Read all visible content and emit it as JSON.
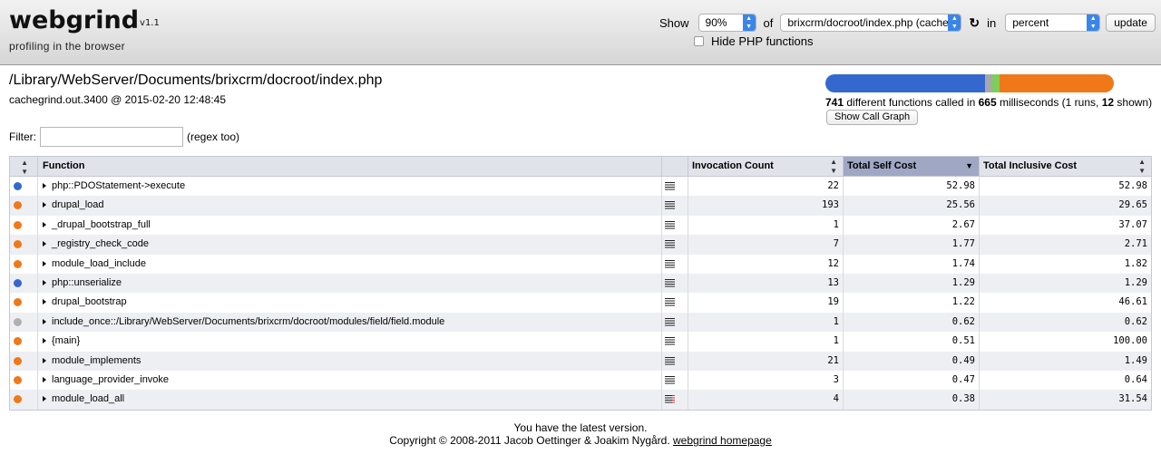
{
  "header": {
    "logo_name": "webgrind",
    "logo_version": "v1.1",
    "tagline": "profiling in the browser",
    "show_label": "Show",
    "percent_select": "90%",
    "of_label": "of",
    "file_select": "brixcrm/docroot/index.php (cache",
    "in_label": "in",
    "unit_select": "percent",
    "update_label": "update",
    "hide_php_label": "Hide PHP functions",
    "hide_php_checked": false
  },
  "file": {
    "path": "/Library/WebServer/Documents/brixcrm/docroot/index.php",
    "meta": "cachegrind.out.3400 @ 2015-02-20 12:48:45"
  },
  "filter": {
    "label": "Filter:",
    "value": "",
    "hint": "(regex too)"
  },
  "summary": {
    "functions": "741",
    "text1": "different functions called in",
    "ms": "665",
    "text2": "milliseconds (1 runs,",
    "shown": "12",
    "text3": "shown)",
    "call_graph_label": "Show Call Graph",
    "bar_segments": [
      {
        "name": "internal",
        "fraction": 0.555,
        "color": "#3468cf"
      },
      {
        "name": "include",
        "fraction": 0.025,
        "color": "#a8a8a8"
      },
      {
        "name": "class",
        "fraction": 0.025,
        "color": "#7ccf5a"
      },
      {
        "name": "user",
        "fraction": 0.395,
        "color": "#f07818"
      }
    ]
  },
  "table": {
    "headers": {
      "function": "Function",
      "invocation": "Invocation Count",
      "self": "Total Self Cost",
      "inclusive": "Total Inclusive Cost"
    },
    "sorted_column": "self",
    "rows": [
      {
        "dot": "#3468cf",
        "fn": "php::PDOStatement->execute",
        "inv": "22",
        "self": "52.98",
        "incl": "52.98",
        "red": false
      },
      {
        "dot": "#f07818",
        "fn": "drupal_load",
        "inv": "193",
        "self": "25.56",
        "incl": "29.65",
        "red": false
      },
      {
        "dot": "#f07818",
        "fn": "_drupal_bootstrap_full",
        "inv": "1",
        "self": "2.67",
        "incl": "37.07",
        "red": false
      },
      {
        "dot": "#f07818",
        "fn": "_registry_check_code",
        "inv": "7",
        "self": "1.77",
        "incl": "2.71",
        "red": false
      },
      {
        "dot": "#f07818",
        "fn": "module_load_include",
        "inv": "12",
        "self": "1.74",
        "incl": "1.82",
        "red": false
      },
      {
        "dot": "#3468cf",
        "fn": "php::unserialize",
        "inv": "13",
        "self": "1.29",
        "incl": "1.29",
        "red": false
      },
      {
        "dot": "#f07818",
        "fn": "drupal_bootstrap",
        "inv": "19",
        "self": "1.22",
        "incl": "46.61",
        "red": false
      },
      {
        "dot": "#b0b0b0",
        "fn": "include_once::/Library/WebServer/Documents/brixcrm/docroot/modules/field/field.module",
        "inv": "1",
        "self": "0.62",
        "incl": "0.62",
        "red": false
      },
      {
        "dot": "#f07818",
        "fn": "{main}",
        "inv": "1",
        "self": "0.51",
        "incl": "100.00",
        "red": false
      },
      {
        "dot": "#f07818",
        "fn": "module_implements",
        "inv": "21",
        "self": "0.49",
        "incl": "1.49",
        "red": false
      },
      {
        "dot": "#f07818",
        "fn": "language_provider_invoke",
        "inv": "3",
        "self": "0.47",
        "incl": "0.64",
        "red": false
      },
      {
        "dot": "#f07818",
        "fn": "module_load_all",
        "inv": "4",
        "self": "0.38",
        "incl": "31.54",
        "red": true
      }
    ]
  },
  "footer": {
    "version_text": "You have the latest version.",
    "copyright": "Copyright © 2008-2011 Jacob Oettinger & Joakim Nygård.",
    "homepage_link": "webgrind homepage"
  }
}
